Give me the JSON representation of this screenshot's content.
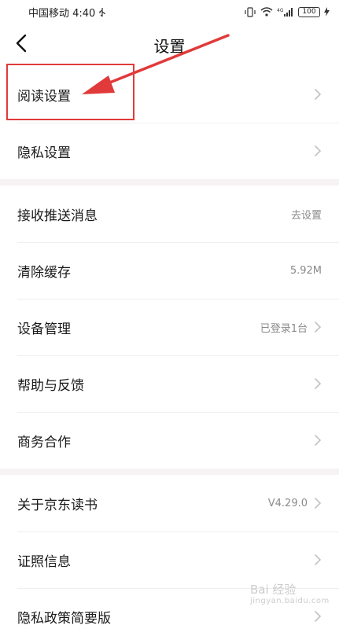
{
  "status_bar": {
    "carrier_time": "中国移动 4:40",
    "network": "4G",
    "battery": "100"
  },
  "header": {
    "title": "设置"
  },
  "sections": [
    {
      "items": [
        {
          "label": "阅读设置",
          "value": ""
        },
        {
          "label": "隐私设置",
          "value": ""
        }
      ]
    },
    {
      "items": [
        {
          "label": "接收推送消息",
          "value": "去设置"
        },
        {
          "label": "清除缓存",
          "value": "5.92M"
        },
        {
          "label": "设备管理",
          "value": "已登录1台"
        },
        {
          "label": "帮助与反馈",
          "value": ""
        },
        {
          "label": "商务合作",
          "value": ""
        }
      ]
    },
    {
      "items": [
        {
          "label": "关于京东读书",
          "value": "V4.29.0"
        },
        {
          "label": "证照信息",
          "value": ""
        },
        {
          "label": "隐私政策简要版",
          "value": ""
        }
      ]
    }
  ],
  "icons": {
    "back": "chevron-left-icon",
    "row_chevron": "chevron-right-icon",
    "annotation_arrow": "red-arrow-icon"
  },
  "colors": {
    "annotation": "#e13a3a",
    "section_gap": "#f7f2f4",
    "value_text": "#8a8a8a"
  },
  "watermark": {
    "brand": "Bai 经验",
    "url": "jingyan.baidu.com"
  }
}
